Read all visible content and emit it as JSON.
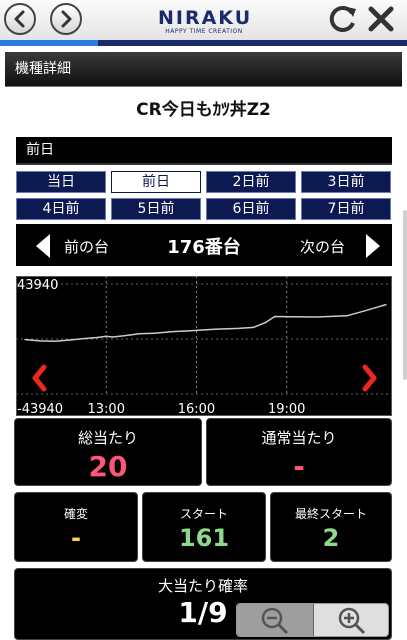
{
  "colors": {
    "accent_navy": "#0d1a52",
    "progress_blue": "#2d7be0",
    "pink_value": "#ff5577",
    "yellow_value": "#ffd54a",
    "green_value": "#8fd98c",
    "chart_arrow_red": "#e8291c"
  },
  "topbar": {
    "back_icon": "chevron-left-circle-icon",
    "forward_icon": "chevron-right-circle-icon",
    "logo_text": "NIRAKU",
    "logo_tagline": "HAPPY TIME CREATION",
    "reload_icon": "reload-icon",
    "close_icon": "close-icon",
    "page_load_progress": 0.24
  },
  "section_title": "機種詳細",
  "machine_name": "CR今日もｶﾂ丼Z2",
  "selected_day_label": "前日",
  "day_buttons": [
    "当日",
    "前日",
    "2日前",
    "3日前",
    "4日前",
    "5日前",
    "6日前",
    "7日前"
  ],
  "selected_day_index": 1,
  "machine_nav": {
    "prev_label": "前の台",
    "number": "176番台",
    "next_label": "次の台"
  },
  "chart_data": {
    "type": "line",
    "ylim": [
      -43940,
      43940
    ],
    "y_tick_labels": [
      "43940",
      "-43940"
    ],
    "x_tick_labels": [
      "13:00",
      "16:00",
      "19:00"
    ],
    "x_ticks_hours": [
      13,
      16,
      19
    ],
    "x_range_hours": [
      10,
      22.5
    ],
    "grid": "dashed vertical and horizontal",
    "series": [
      {
        "color": "#cccccc",
        "points": [
          [
            10.3,
            -500
          ],
          [
            10.8,
            -1500
          ],
          [
            11.3,
            -1800
          ],
          [
            11.8,
            -800
          ],
          [
            12.2,
            200
          ],
          [
            12.7,
            1200
          ],
          [
            13.0,
            2200
          ],
          [
            13.2,
            1600
          ],
          [
            13.6,
            2600
          ],
          [
            14.1,
            4200
          ],
          [
            14.6,
            4600
          ],
          [
            15.2,
            5900
          ],
          [
            15.8,
            6600
          ],
          [
            16.6,
            7800
          ],
          [
            17.4,
            8500
          ],
          [
            17.9,
            9300
          ],
          [
            18.3,
            13200
          ],
          [
            18.6,
            18000
          ],
          [
            19.1,
            17700
          ],
          [
            20.0,
            17600
          ],
          [
            21.0,
            18500
          ],
          [
            21.6,
            22500
          ],
          [
            22.3,
            27500
          ]
        ]
      }
    ]
  },
  "stats": {
    "total_hits_label": "総当たり",
    "total_hits_value": "20",
    "normal_hits_label": "通常当たり",
    "normal_hits_value": "-",
    "probability_change_label": "確変",
    "probability_change_value": "-",
    "start_label": "スタート",
    "start_value": "161",
    "last_start_label": "最終スタート",
    "last_start_value": "2",
    "jackpot_rate_label": "大当たり確率",
    "jackpot_rate_value": "1/9"
  },
  "zoom": {
    "out_icon": "zoom-out-icon",
    "in_icon": "zoom-in-icon"
  }
}
